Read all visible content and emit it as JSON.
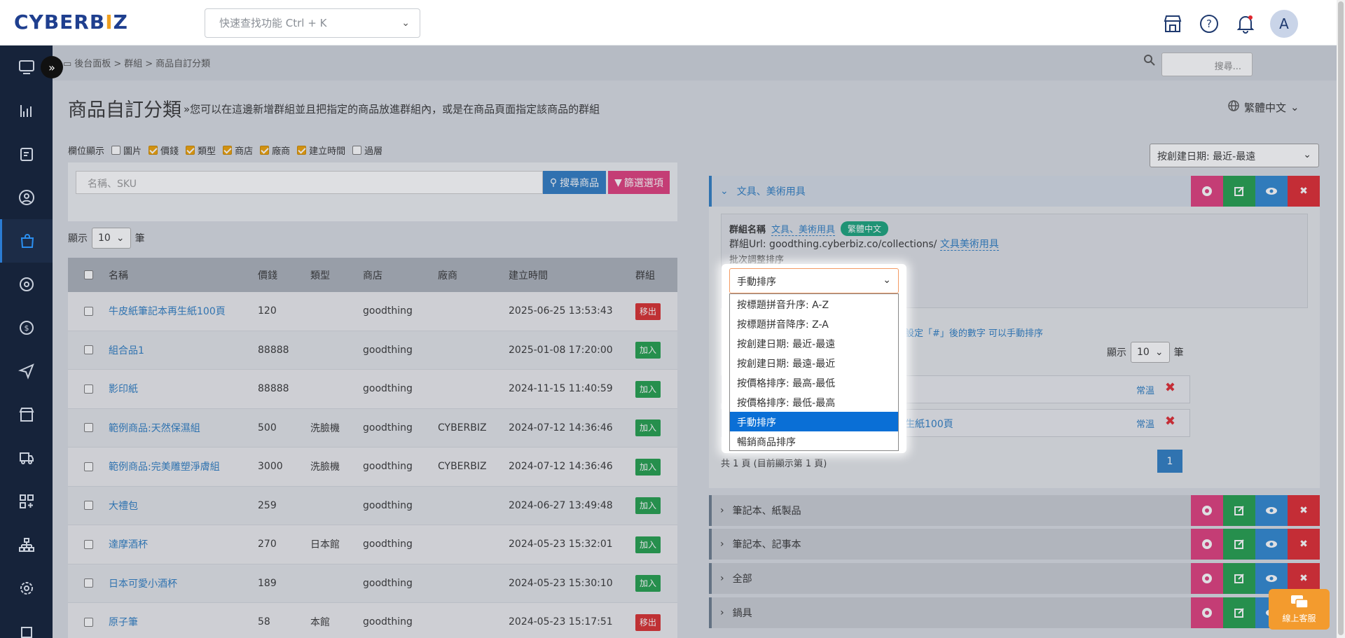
{
  "header": {
    "logo_main": "CYBERB",
    "logo_accent": "I",
    "logo_end": "Z",
    "quick_placeholder": "快速查找功能 Ctrl + K",
    "avatar_letter": "A"
  },
  "breadcrumb": {
    "items": [
      "後台面板",
      "群組",
      "商品自訂分類"
    ],
    "sep": ">"
  },
  "top_search_placeholder": "搜尋...",
  "page": {
    "title": "商品自訂分類",
    "subtitle": "»您可以在這邊新增群組並且把指定的商品放進群組內，或是在商品頁面指定該商品的群組",
    "language": "繁體中文"
  },
  "columns_display": {
    "label": "欄位顯示",
    "options": [
      {
        "label": "圖片",
        "checked": false
      },
      {
        "label": "價錢",
        "checked": true
      },
      {
        "label": "類型",
        "checked": true
      },
      {
        "label": "商店",
        "checked": true
      },
      {
        "label": "廠商",
        "checked": true
      },
      {
        "label": "建立時間",
        "checked": true
      },
      {
        "label": "過層",
        "checked": false
      }
    ]
  },
  "search": {
    "placeholder": "名稱、SKU",
    "search_button": "搜尋商品",
    "filter_button": "篩選選項"
  },
  "paging": {
    "show_label": "顯示",
    "count": "10",
    "unit": "筆"
  },
  "table": {
    "headers": [
      "名稱",
      "價錢",
      "類型",
      "商店",
      "廠商",
      "建立時間",
      "群組"
    ],
    "rows": [
      {
        "name": "牛皮紙筆記本再生紙100頁",
        "price": "120",
        "type": "",
        "store": "goodthing",
        "vendor": "",
        "created": "2025-06-25 13:53:43",
        "action": "移出"
      },
      {
        "name": "組合品1",
        "price": "88888",
        "type": "",
        "store": "goodthing",
        "vendor": "",
        "created": "2025-01-08 17:20:00",
        "action": "加入"
      },
      {
        "name": "影印紙",
        "price": "88888",
        "type": "",
        "store": "goodthing",
        "vendor": "",
        "created": "2024-11-15 11:40:59",
        "action": "加入"
      },
      {
        "name": "範例商品:天然保濕組",
        "price": "500",
        "type": "洗臉機",
        "store": "goodthing",
        "vendor": "CYBERBIZ",
        "created": "2024-07-12 14:36:46",
        "action": "加入"
      },
      {
        "name": "範例商品:完美雕塑淨膚組",
        "price": "3000",
        "type": "洗臉機",
        "store": "goodthing",
        "vendor": "CYBERBIZ",
        "created": "2024-07-12 14:36:46",
        "action": "加入"
      },
      {
        "name": "大禮包",
        "price": "259",
        "type": "",
        "store": "goodthing",
        "vendor": "",
        "created": "2024-06-27 13:49:48",
        "action": "加入"
      },
      {
        "name": "達摩酒杯",
        "price": "270",
        "type": "日本館",
        "store": "goodthing",
        "vendor": "",
        "created": "2024-05-23 15:32:01",
        "action": "加入"
      },
      {
        "name": "日本可愛小酒杯",
        "price": "189",
        "type": "",
        "store": "goodthing",
        "vendor": "",
        "created": "2024-05-23 15:30:10",
        "action": "加入"
      },
      {
        "name": "原子筆",
        "price": "58",
        "type": "本館",
        "store": "goodthing",
        "vendor": "",
        "created": "2024-05-23 15:17:51",
        "action": "移出"
      }
    ]
  },
  "group_sort": "按創建日期: 最近-最遠",
  "groups": [
    {
      "name": "文具、美術用具",
      "open": true
    },
    {
      "name": "筆記本、紙製品",
      "open": false
    },
    {
      "name": "筆記本、記事本",
      "open": false
    },
    {
      "name": "全部",
      "open": false
    },
    {
      "name": "鍋具",
      "open": false
    }
  ],
  "group_detail": {
    "name_label": "群組名稱",
    "name_value": "文具、美術用具",
    "lang_badge": "繁體中文",
    "url_label": "群組Url: goodthing.cyberbiz.co/collections/",
    "url_slug": "文具美術用具",
    "batch_label": "批次調整排序",
    "hint": "或設定「#」後的數字 可以手動排序",
    "show_label": "顯示",
    "show_count": "10",
    "show_unit": "筆",
    "products": [
      {
        "name": "",
        "status": "常溫"
      },
      {
        "name": "再生紙100頁",
        "status": "常溫"
      }
    ],
    "page_info": "共 1 頁 (目前顯示第 1 頁)",
    "page_num": "1"
  },
  "sort_dropdown": {
    "selected": "手動排序",
    "options": [
      "按標題拼音升序: A-Z",
      "按標題拼音降序: Z-A",
      "按創建日期: 最近-最遠",
      "按創建日期: 最遠-最近",
      "按價格排序: 最高-最低",
      "按價格排序: 最低-最高",
      "手動排序",
      "暢銷商品排序"
    ],
    "highlighted_index": 6
  },
  "chat": {
    "label": "線上客服"
  }
}
